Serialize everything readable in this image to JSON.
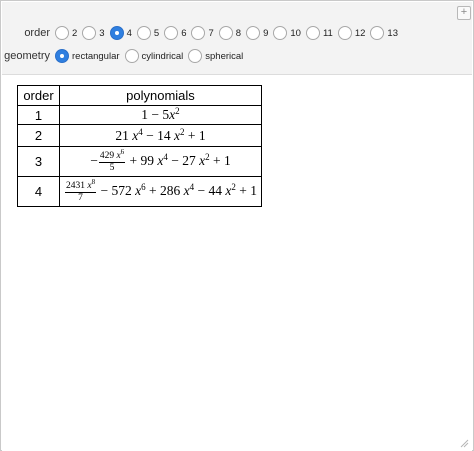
{
  "controls": {
    "order_label": "order",
    "order_options": [
      "2",
      "3",
      "4",
      "5",
      "6",
      "7",
      "8",
      "9",
      "10",
      "11",
      "12",
      "13"
    ],
    "order_selected": "4",
    "geometry_label": "geometry",
    "geometry_options": [
      "rectangular",
      "cylindrical",
      "spherical"
    ],
    "geometry_selected": "rectangular",
    "plus_glyph": "+"
  },
  "table": {
    "headers": [
      "order",
      "polynomials"
    ],
    "rows": [
      {
        "order": "1"
      },
      {
        "order": "2"
      },
      {
        "order": "3"
      },
      {
        "order": "4"
      }
    ],
    "p1": {
      "one": "1",
      "minus": " − 5",
      "x": "x",
      "exp": "2"
    },
    "p2": {
      "a": "21",
      "x": "x",
      "e1": "4",
      "b": " − 14",
      "e2": "2",
      "c": " + 1"
    },
    "p3": {
      "neg": "−",
      "num_coef": "429",
      "num_x": "x",
      "num_exp": "6",
      "den": "5",
      "b": " + 99",
      "e2": "4",
      "c": " − 27",
      "e3": "2",
      "d": " + 1"
    },
    "p4": {
      "num_coef": "2431",
      "num_x": "x",
      "num_exp": "8",
      "den": "7",
      "b": " − 572",
      "e2": "6",
      "c": " + 286",
      "e3": "4",
      "d": " − 44",
      "e4": "2",
      "f": " + 1"
    }
  }
}
